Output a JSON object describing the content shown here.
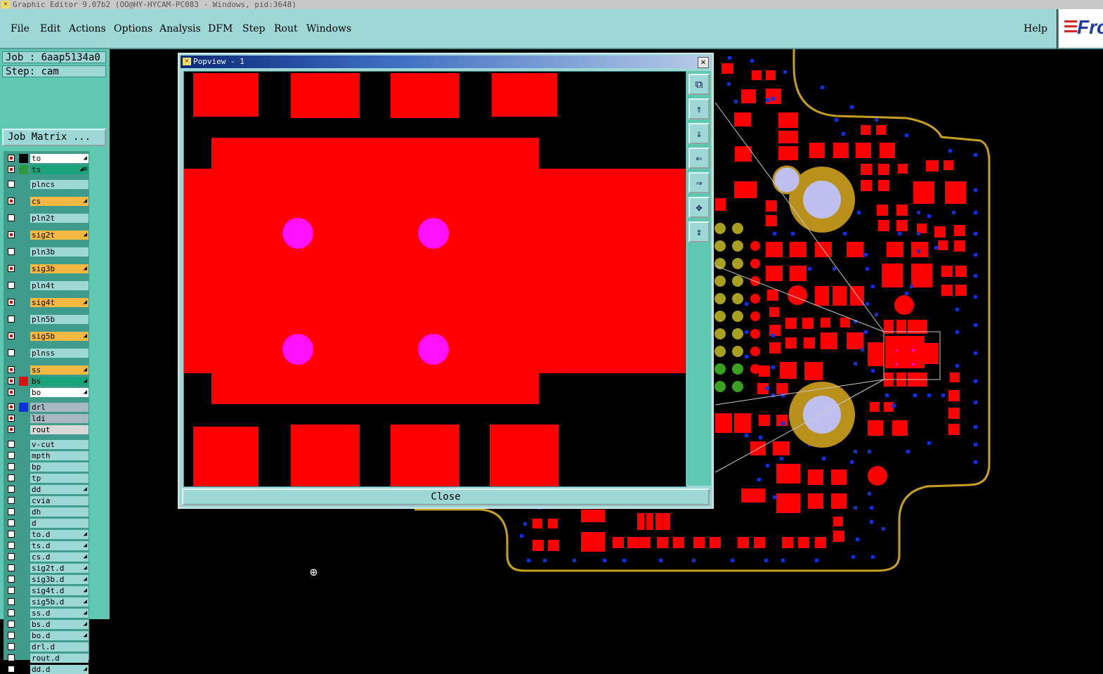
{
  "window": {
    "title": "Graphic Editor 9.07b2  (OO@HY-HYCAM-PC083 - Windows, pid:3648)"
  },
  "menu": {
    "items": [
      {
        "label": "File"
      },
      {
        "label": "Edit"
      },
      {
        "label": "Actions"
      },
      {
        "label": "Options"
      },
      {
        "label": "Analysis"
      },
      {
        "label": "DFM"
      },
      {
        "label": "Step"
      },
      {
        "label": "Rout"
      },
      {
        "label": "Windows"
      }
    ],
    "help": "Help",
    "logo_text": "Fro"
  },
  "job": {
    "job_label": "Job : 6aap5134a0",
    "step_label": "Step: cam",
    "matrix_button": "Job Matrix ..."
  },
  "layers": [
    {
      "name": "to",
      "checked": true,
      "swatch": "#000000",
      "bg": "#ffffff",
      "icon": "◢"
    },
    {
      "name": "ts",
      "checked": true,
      "swatch": "#2a9a3a",
      "bg": "#1aa37a",
      "icon": "◢⊞"
    },
    {
      "name": "plncs",
      "checked": false,
      "swatch": "",
      "bg": "#9ed8d6",
      "icon": ""
    },
    {
      "name": "cs",
      "checked": true,
      "swatch": "",
      "bg": "#f5b941",
      "icon": "◢"
    },
    {
      "name": "pln2t",
      "checked": false,
      "swatch": "",
      "bg": "#9ed8d6",
      "icon": ""
    },
    {
      "name": "sig2t",
      "checked": true,
      "swatch": "",
      "bg": "#f5b941",
      "icon": "◢"
    },
    {
      "name": "pln3b",
      "checked": false,
      "swatch": "",
      "bg": "#9ed8d6",
      "icon": ""
    },
    {
      "name": "sig3b",
      "checked": true,
      "swatch": "",
      "bg": "#f5b941",
      "icon": "◢"
    },
    {
      "name": "pln4t",
      "checked": false,
      "swatch": "",
      "bg": "#9ed8d6",
      "icon": ""
    },
    {
      "name": "sig4t",
      "checked": true,
      "swatch": "",
      "bg": "#f5b941",
      "icon": "◢"
    },
    {
      "name": "pln5b",
      "checked": false,
      "swatch": "",
      "bg": "#9ed8d6",
      "icon": ""
    },
    {
      "name": "sig5b",
      "checked": true,
      "swatch": "",
      "bg": "#f5b941",
      "icon": "◢"
    },
    {
      "name": "plnss",
      "checked": false,
      "swatch": "",
      "bg": "#9ed8d6",
      "icon": ""
    },
    {
      "name": "ss",
      "checked": true,
      "swatch": "",
      "bg": "#f5b941",
      "icon": "◢"
    },
    {
      "name": "bs",
      "checked": true,
      "swatch": "#e01010",
      "bg": "#1aa37a",
      "icon": "◢"
    },
    {
      "name": "bo",
      "checked": true,
      "swatch": "",
      "bg": "#ffffff",
      "icon": "◢"
    },
    {
      "name": "drl",
      "checked": true,
      "swatch": "#1030e0",
      "bg": "#a8b8c0",
      "icon": ""
    },
    {
      "name": "ldi",
      "checked": true,
      "swatch": "",
      "bg": "#a8b8c0",
      "icon": ""
    },
    {
      "name": "rout",
      "checked": true,
      "swatch": "",
      "bg": "#d8d8d8",
      "icon": ""
    },
    {
      "name": "v-cut",
      "checked": false,
      "swatch": "",
      "bg": "#9ed8d6",
      "icon": ""
    },
    {
      "name": "mpth",
      "checked": false,
      "swatch": "",
      "bg": "#9ed8d6",
      "icon": ""
    },
    {
      "name": "bp",
      "checked": false,
      "swatch": "",
      "bg": "#9ed8d6",
      "icon": ""
    },
    {
      "name": "tp",
      "checked": false,
      "swatch": "",
      "bg": "#9ed8d6",
      "icon": ""
    },
    {
      "name": "dd",
      "checked": false,
      "swatch": "",
      "bg": "#9ed8d6",
      "icon": "◢"
    },
    {
      "name": "cvia",
      "checked": false,
      "swatch": "",
      "bg": "#9ed8d6",
      "icon": ""
    },
    {
      "name": "dh",
      "checked": false,
      "swatch": "",
      "bg": "#9ed8d6",
      "icon": ""
    },
    {
      "name": "d",
      "checked": false,
      "swatch": "",
      "bg": "#9ed8d6",
      "icon": ""
    },
    {
      "name": "to.d",
      "checked": false,
      "swatch": "",
      "bg": "#9ed8d6",
      "icon": "◢"
    },
    {
      "name": "ts.d",
      "checked": false,
      "swatch": "",
      "bg": "#9ed8d6",
      "icon": "◢"
    },
    {
      "name": "cs.d",
      "checked": false,
      "swatch": "",
      "bg": "#9ed8d6",
      "icon": "◢"
    },
    {
      "name": "sig2t.d",
      "checked": false,
      "swatch": "",
      "bg": "#9ed8d6",
      "icon": "◢"
    },
    {
      "name": "sig3b.d",
      "checked": false,
      "swatch": "",
      "bg": "#9ed8d6",
      "icon": "◢"
    },
    {
      "name": "sig4t.d",
      "checked": false,
      "swatch": "",
      "bg": "#9ed8d6",
      "icon": "◢"
    },
    {
      "name": "sig5b.d",
      "checked": false,
      "swatch": "",
      "bg": "#9ed8d6",
      "icon": "◢"
    },
    {
      "name": "ss.d",
      "checked": false,
      "swatch": "",
      "bg": "#9ed8d6",
      "icon": "◢"
    },
    {
      "name": "bs.d",
      "checked": false,
      "swatch": "",
      "bg": "#9ed8d6",
      "icon": "◢"
    },
    {
      "name": "bo.d",
      "checked": false,
      "swatch": "",
      "bg": "#9ed8d6",
      "icon": "◢"
    },
    {
      "name": "drl.d",
      "checked": false,
      "swatch": "",
      "bg": "#9ed8d6",
      "icon": ""
    },
    {
      "name": "rout.d",
      "checked": false,
      "swatch": "",
      "bg": "#9ed8d6",
      "icon": ""
    },
    {
      "name": "dd.d",
      "checked": false,
      "swatch": "",
      "bg": "#9ed8d6",
      "icon": "◢"
    }
  ],
  "popview": {
    "title": "Popview - 1",
    "close_label": "Close",
    "tools": [
      {
        "icon": "zoom-window-icon",
        "glyph": "⧉"
      },
      {
        "icon": "arrow-up-icon",
        "glyph": "⇑"
      },
      {
        "icon": "arrow-down-icon",
        "glyph": "⇓"
      },
      {
        "icon": "arrow-left-icon",
        "glyph": "⇐"
      },
      {
        "icon": "arrow-right-icon",
        "glyph": "⇒"
      },
      {
        "icon": "zoom-in-icon",
        "glyph": "✥"
      },
      {
        "icon": "zoom-out-icon",
        "glyph": "⇕"
      }
    ]
  },
  "colors": {
    "accent_panel": "#9ed8d6",
    "pad_red": "#ff0000",
    "drill_magenta": "#ff10ff",
    "board_outline": "#c8a020",
    "via_blue": "#1030e0",
    "hole_lavender": "#c0c0f0"
  }
}
